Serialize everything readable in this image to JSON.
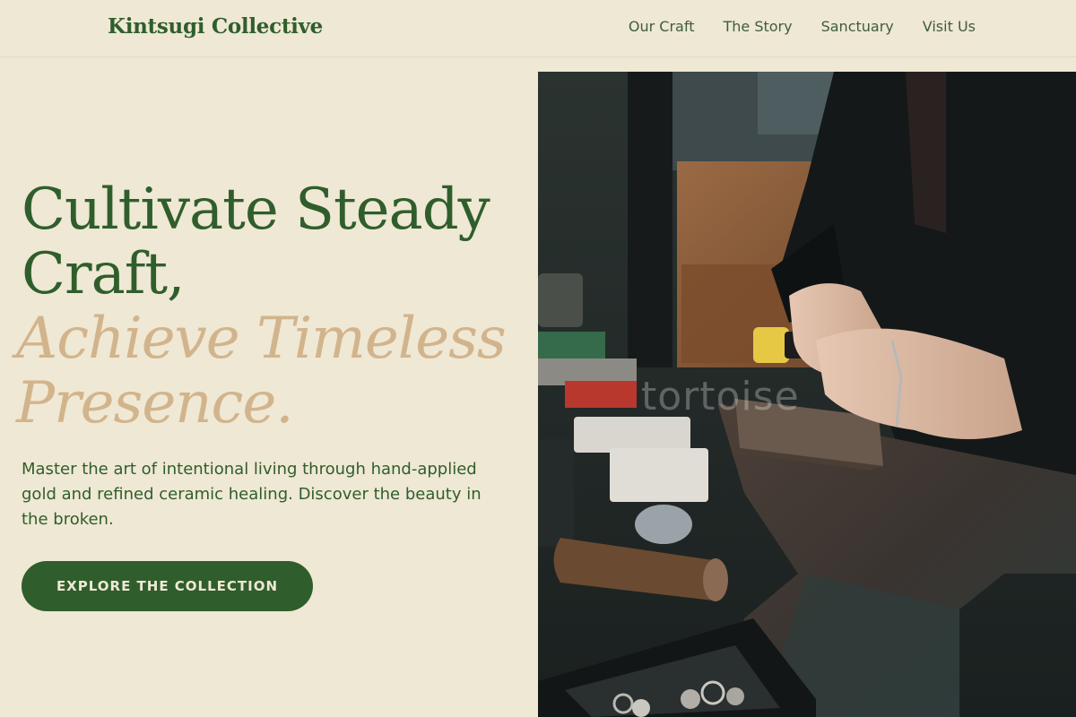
{
  "header": {
    "logo": "Kintsugi Collective",
    "nav": [
      {
        "label": "Our Craft"
      },
      {
        "label": "The Story"
      },
      {
        "label": "Sanctuary"
      },
      {
        "label": "Visit Us"
      }
    ]
  },
  "hero": {
    "title_line1": "Cultivate Steady",
    "title_line2": "Craft,",
    "title_line3": "Achieve Timeless",
    "title_line4": "Presence.",
    "description": "Master the art of intentional living through hand-applied gold and refined ceramic healing. Discover the beauty in the broken.",
    "cta_label": "EXPLORE THE COLLECTION"
  },
  "photo": {
    "watermark": "tortoise"
  },
  "colors": {
    "background": "#efe8d4",
    "primary_green": "#2f5e2c",
    "accent_gold": "#d2b48c"
  }
}
